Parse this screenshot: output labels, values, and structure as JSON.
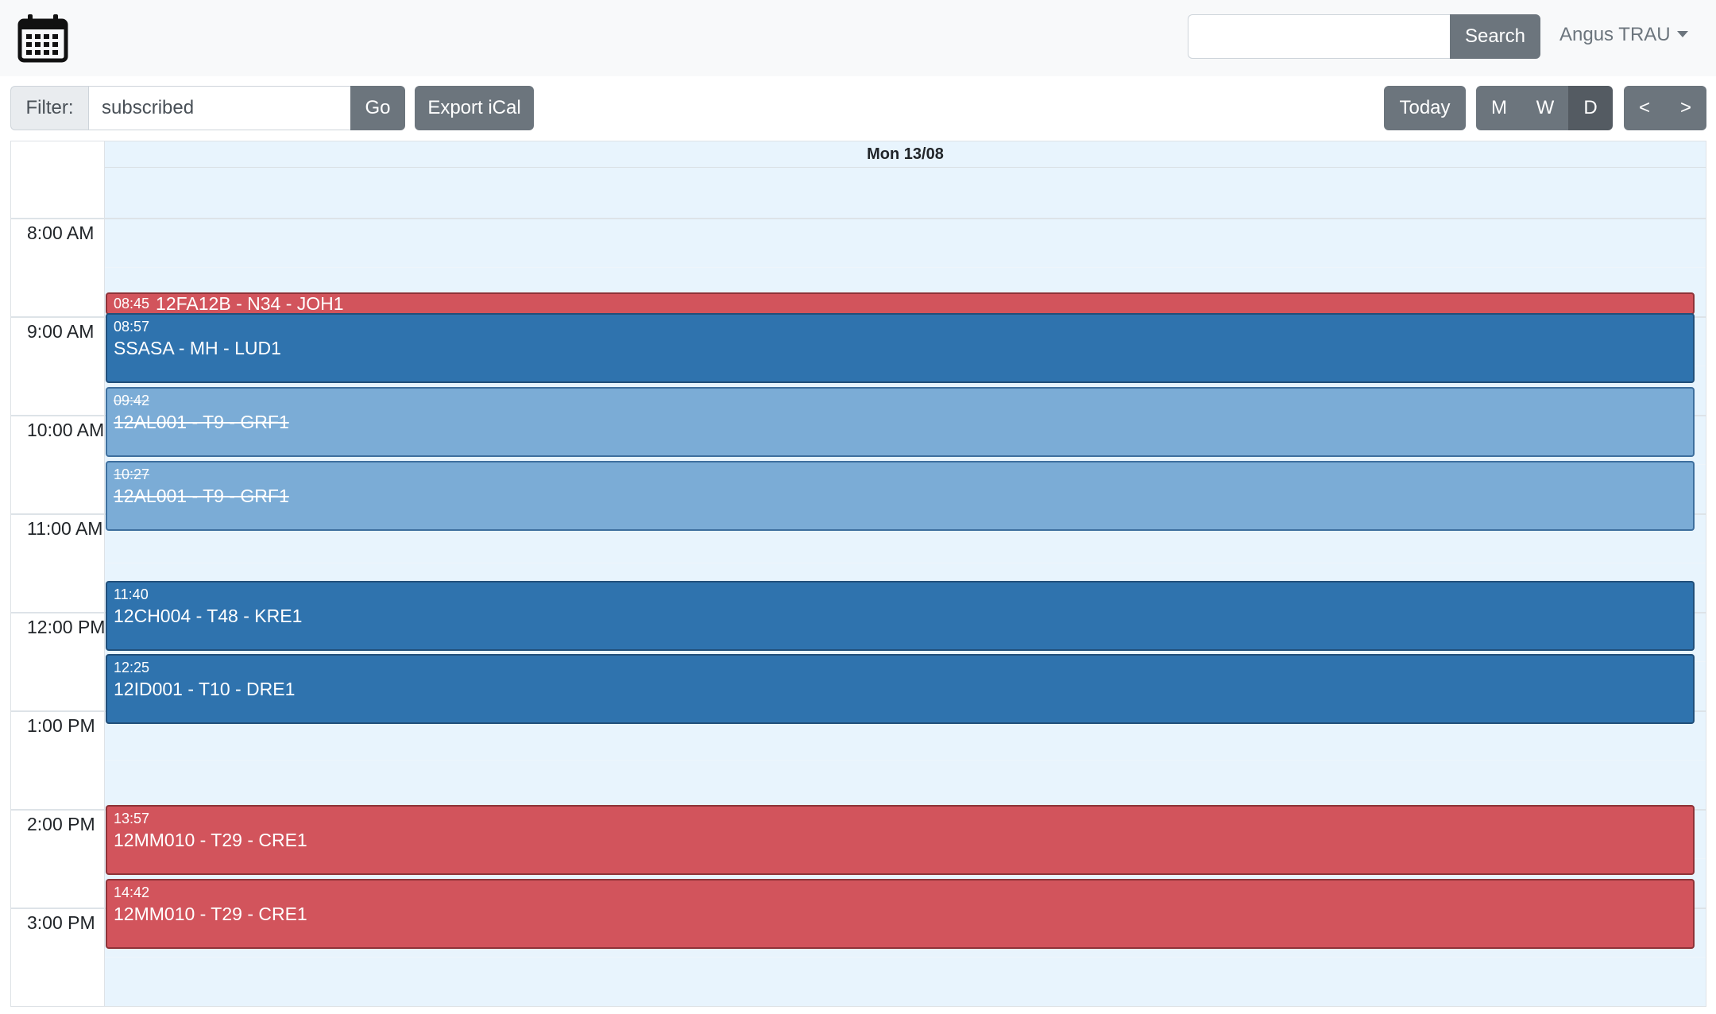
{
  "header": {
    "logo_icon": "calendar-icon",
    "search": {
      "placeholder": "",
      "value": "",
      "button_label": "Search"
    },
    "user": {
      "name": "Angus TRAU"
    }
  },
  "toolbar": {
    "filter_label": "Filter:",
    "filter_value": "subscribed",
    "go_label": "Go",
    "export_label": "Export iCal",
    "today_label": "Today",
    "view_month_label": "M",
    "view_week_label": "W",
    "view_day_label": "D",
    "active_view": "D",
    "prev_label": "<",
    "next_label": ">"
  },
  "calendar": {
    "day_header": "Mon 13/08",
    "time_labels": [
      "8:00 AM",
      "9:00 AM",
      "10:00 AM",
      "11:00 AM",
      "12:00 PM",
      "1:00 PM",
      "2:00 PM",
      "3:00 PM"
    ],
    "events": [
      {
        "time": "08:45",
        "title": "12FA12B - N34 - JOH1",
        "color": "red",
        "cancelled": false
      },
      {
        "time": "08:57",
        "title": "SSASA - MH - LUD1",
        "color": "dark",
        "cancelled": false
      },
      {
        "time": "09:42",
        "title": "12AL001 - T9 - GRF1",
        "color": "light",
        "cancelled": true
      },
      {
        "time": "10:27",
        "title": "12AL001 - T9 - GRF1",
        "color": "light",
        "cancelled": true
      },
      {
        "time": "11:40",
        "title": "12CH004 - T48 - KRE1",
        "color": "dark",
        "cancelled": false
      },
      {
        "time": "12:25",
        "title": "12ID001 - T10 - DRE1",
        "color": "dark",
        "cancelled": false
      },
      {
        "time": "13:57",
        "title": "12MM010 - T29 - CRE1",
        "color": "red",
        "cancelled": false
      },
      {
        "time": "14:42",
        "title": "12MM010 - T29 - CRE1",
        "color": "red",
        "cancelled": false
      }
    ]
  },
  "colors": {
    "navbar_bg": "#f8f9fa",
    "button_secondary": "#6c757d",
    "button_active": "#545b62",
    "event_dark": "#2f73ae",
    "event_light": "#7bacd6",
    "event_red": "#d2545c",
    "day_bg": "#e8f4fd"
  }
}
